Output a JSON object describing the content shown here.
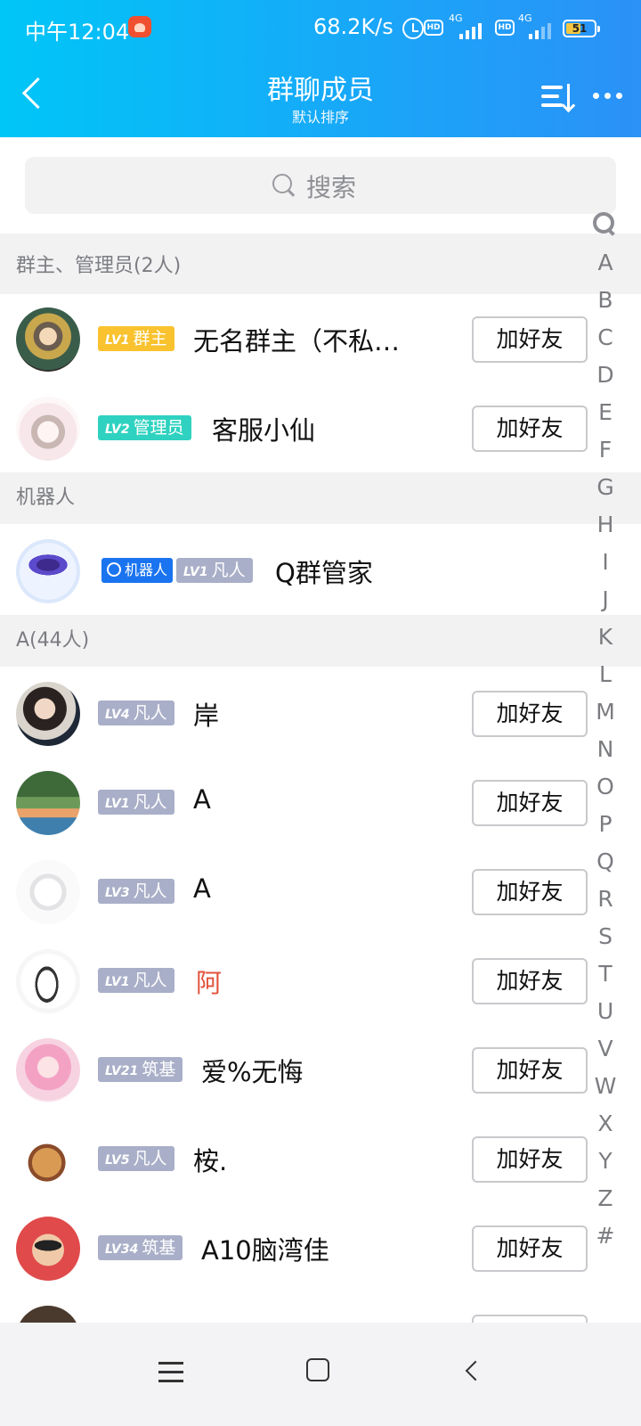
{
  "status_bar": {
    "time": "中午12:04",
    "net_speed": "68.2K/s",
    "hd1": "HD",
    "sig1": "4G",
    "hd2": "HD",
    "sig2": "4G",
    "battery": "51",
    "battery_color": "#f3c640"
  },
  "header": {
    "title": "群聊成员",
    "subtitle": "默认排序",
    "gradient": [
      "#00c6f7",
      "#2b91f7"
    ]
  },
  "search": {
    "placeholder": "搜索"
  },
  "sections": {
    "admins": "群主、管理员(2人)",
    "robots": "机器人",
    "a": "A(44人)"
  },
  "add_friend_label": "加好友",
  "members": [
    {
      "badges": [
        {
          "lv": "LV1",
          "text": "群主"
        }
      ],
      "name": "无名群主（不私…"
    },
    {
      "badges": [
        {
          "lv": "LV2",
          "text": "管理员"
        }
      ],
      "name": "客服小仙"
    },
    {
      "badges": [
        {
          "lv": "",
          "text": "机器人"
        },
        {
          "lv": "LV1",
          "text": "凡人"
        }
      ],
      "name": "Q群管家"
    },
    {
      "badges": [
        {
          "lv": "LV4",
          "text": "凡人"
        }
      ],
      "name": "岸"
    },
    {
      "badges": [
        {
          "lv": "LV1",
          "text": "凡人"
        }
      ],
      "name": "A"
    },
    {
      "badges": [
        {
          "lv": "LV3",
          "text": "凡人"
        }
      ],
      "name": "A"
    },
    {
      "badges": [
        {
          "lv": "LV1",
          "text": "凡人"
        }
      ],
      "name": "阿",
      "name_color": "#e2513a"
    },
    {
      "badges": [
        {
          "lv": "LV21",
          "text": "筑基"
        }
      ],
      "name": "爱%无悔"
    },
    {
      "badges": [
        {
          "lv": "LV5",
          "text": "凡人"
        }
      ],
      "name": "桉."
    },
    {
      "badges": [
        {
          "lv": "LV34",
          "text": "筑基"
        }
      ],
      "name": "A10脑湾佳"
    }
  ],
  "index_letters": [
    "A",
    "B",
    "C",
    "D",
    "E",
    "F",
    "G",
    "H",
    "I",
    "J",
    "K",
    "L",
    "M",
    "N",
    "O",
    "P",
    "Q",
    "R",
    "S",
    "T",
    "U",
    "V",
    "W",
    "X",
    "Y",
    "Z",
    "#"
  ]
}
